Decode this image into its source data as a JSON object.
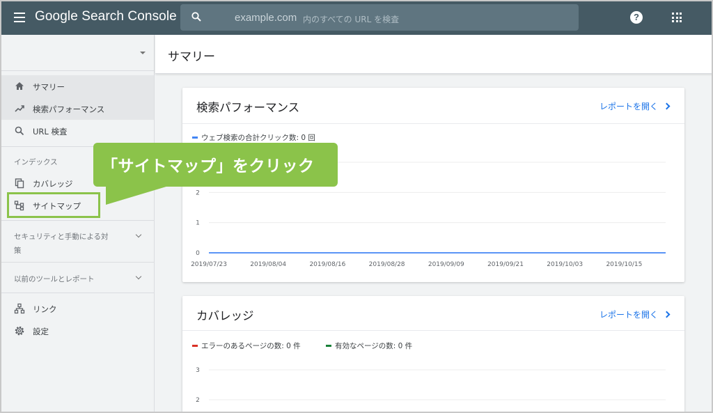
{
  "app": {
    "title": "Google Search Console"
  },
  "search": {
    "domain": "example.com",
    "placeholder": "内のすべての URL を検査"
  },
  "header_icons": [
    "help-icon",
    "apps-grid-icon"
  ],
  "sidebar": {
    "items_top": [
      {
        "label": "サマリー",
        "icon": "home-icon",
        "active": true
      },
      {
        "label": "検索パフォーマンス",
        "icon": "trending-up-icon",
        "active": true
      },
      {
        "label": "URL 検査",
        "icon": "search-icon",
        "active": false
      }
    ],
    "index_section": "インデックス",
    "items_index": [
      {
        "label": "カバレッジ",
        "icon": "copy-icon"
      },
      {
        "label": "サイトマップ",
        "icon": "sitemap-icon"
      }
    ],
    "security_section_line1": "セキュリティと手動による対",
    "security_section_line2": "策",
    "legacy_section": "以前のツールとレポート",
    "items_bottom": [
      {
        "label": "リンク",
        "icon": "links-icon"
      },
      {
        "label": "設定",
        "icon": "gear-icon"
      }
    ]
  },
  "main": {
    "page_title": "サマリー"
  },
  "performance_card": {
    "title": "検索パフォーマンス",
    "link": "レポートを開く",
    "legend": "ウェブ検索の合計クリック数: 0 回",
    "legend_color": "#4285f4"
  },
  "coverage_card": {
    "title": "カバレッジ",
    "link": "レポートを開く",
    "legend_error": "エラーのあるページの数: 0 件",
    "legend_error_color": "#d93025",
    "legend_valid": "有効なページの数: 0 件",
    "legend_valid_color": "#188038"
  },
  "chart_data": [
    {
      "type": "line",
      "title": "",
      "x": [
        "2019/07/23",
        "2019/08/04",
        "2019/08/16",
        "2019/08/28",
        "2019/09/09",
        "2019/09/21",
        "2019/10/03",
        "2019/10/15"
      ],
      "series": [
        {
          "name": "ウェブ検索の合計クリック数: 0 回",
          "values": [
            0,
            0,
            0,
            0,
            0,
            0,
            0,
            0
          ],
          "color": "#4285f4"
        }
      ],
      "yticks": [
        "0",
        "1",
        "2"
      ],
      "ylim": [
        0,
        3
      ],
      "grid": true
    },
    {
      "type": "line",
      "title": "",
      "series": [
        {
          "name": "エラーのあるページの数: 0 件",
          "values": [],
          "color": "#d93025"
        },
        {
          "name": "有効なページの数: 0 件",
          "values": [],
          "color": "#188038"
        }
      ],
      "yticks": [
        "2",
        "3"
      ],
      "grid": true
    }
  ],
  "callout": {
    "text": "「サイトマップ」をクリック",
    "color": "#8bc34a"
  }
}
